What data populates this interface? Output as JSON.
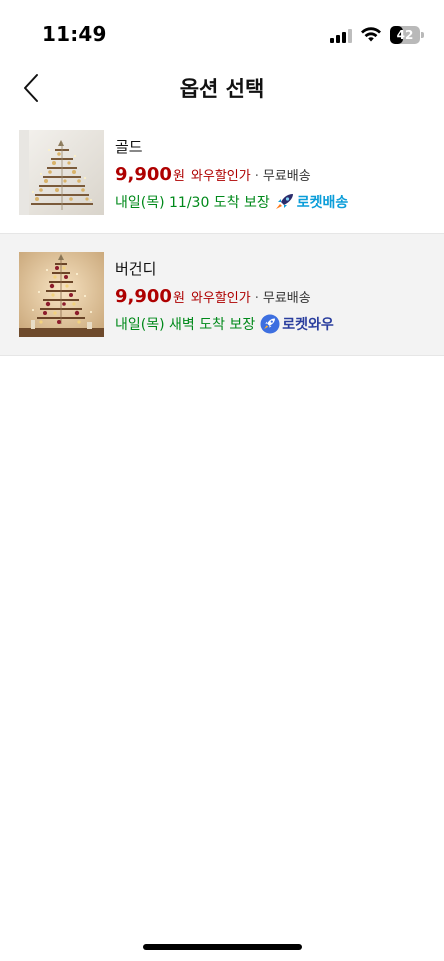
{
  "status_bar": {
    "time": "11:49",
    "battery_level": "42",
    "icons": [
      "signal-icon",
      "wifi-icon",
      "battery-icon"
    ]
  },
  "header": {
    "title": "옵션 선택",
    "back_icon": "chevron-left-icon"
  },
  "options": [
    {
      "name": "골드",
      "price": "9,900",
      "currency": "원",
      "discount_label": "와우할인가",
      "separator": "·",
      "shipping": "무료배송",
      "delivery": "내일(목) 11/30 도착 보장",
      "badge_icon": "rocket-icon",
      "badge_label": "로켓배송",
      "selected": false
    },
    {
      "name": "버건디",
      "price": "9,900",
      "currency": "원",
      "discount_label": "와우할인가",
      "separator": "·",
      "shipping": "무료배송",
      "delivery": "내일(목) 새벽 도착 보장",
      "badge_icon": "rocket-wow-icon",
      "badge_label": "로켓와우",
      "selected": true
    }
  ],
  "colors": {
    "price": "#ae0000",
    "delivery": "#00891a",
    "rocket_badge": "#0a9dd9",
    "wow_badge": "#2a3e9e",
    "selected_row_bg": "#f3f3f3"
  }
}
